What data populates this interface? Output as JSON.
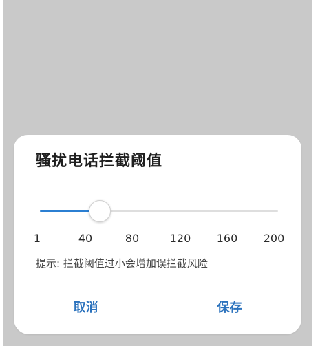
{
  "dialog": {
    "title": "骚扰电话拦截阈值",
    "slider": {
      "min": 1,
      "max": 200,
      "value": 40,
      "fill_color": "#2b7fd2",
      "tick_labels": [
        "1",
        "40",
        "80",
        "120",
        "160",
        "200"
      ]
    },
    "hint": "提示: 拦截阈值过小会增加误拦截风险",
    "buttons": {
      "cancel_label": "取消",
      "save_label": "保存"
    }
  }
}
